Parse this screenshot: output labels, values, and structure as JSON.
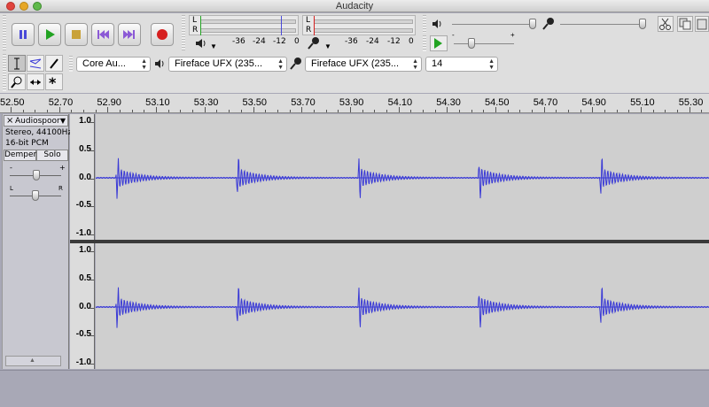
{
  "window": {
    "title": "Audacity"
  },
  "transport": {
    "buttons": [
      {
        "name": "pause-button",
        "icon": "pause-icon"
      },
      {
        "name": "play-button",
        "icon": "play-icon"
      },
      {
        "name": "stop-button",
        "icon": "stop-icon"
      },
      {
        "name": "skip-start-button",
        "icon": "skip-start-icon"
      },
      {
        "name": "skip-end-button",
        "icon": "skip-end-icon"
      },
      {
        "name": "record-button",
        "icon": "record-icon"
      }
    ]
  },
  "meters": {
    "play": {
      "left_label": "L",
      "right_label": "R",
      "scale": [
        "-36",
        "-24",
        "-12",
        "0"
      ]
    },
    "record": {
      "left_label": "L",
      "right_label": "R",
      "scale": [
        "-36",
        "-24",
        "-12",
        "0"
      ]
    }
  },
  "devices": {
    "host": "Core Au...",
    "output": "Fireface UFX (235...",
    "input": "Fireface UFX (235...",
    "channels": "14"
  },
  "ruler": {
    "labels": [
      "52.50",
      "52.70",
      "52.90",
      "53.10",
      "53.30",
      "53.50",
      "53.70",
      "53.90",
      "54.10",
      "54.30",
      "54.50",
      "54.70",
      "54.90",
      "55.10",
      "55.30"
    ]
  },
  "track": {
    "name": "Audiospoor",
    "format": "Stereo, 44100Hz",
    "bitdepth": "16-bit PCM",
    "mute_label": "Dempen",
    "solo_label": "Solo",
    "gain_minus": "-",
    "gain_plus": "+",
    "pan_left": "L",
    "pan_right": "R",
    "amplitude_labels": [
      "1.0",
      "0.5",
      "0.0",
      "-0.5",
      "-1.0"
    ]
  },
  "colors": {
    "waveform": "#3a3ad6",
    "record": "#d62020",
    "play": "#22a322"
  }
}
